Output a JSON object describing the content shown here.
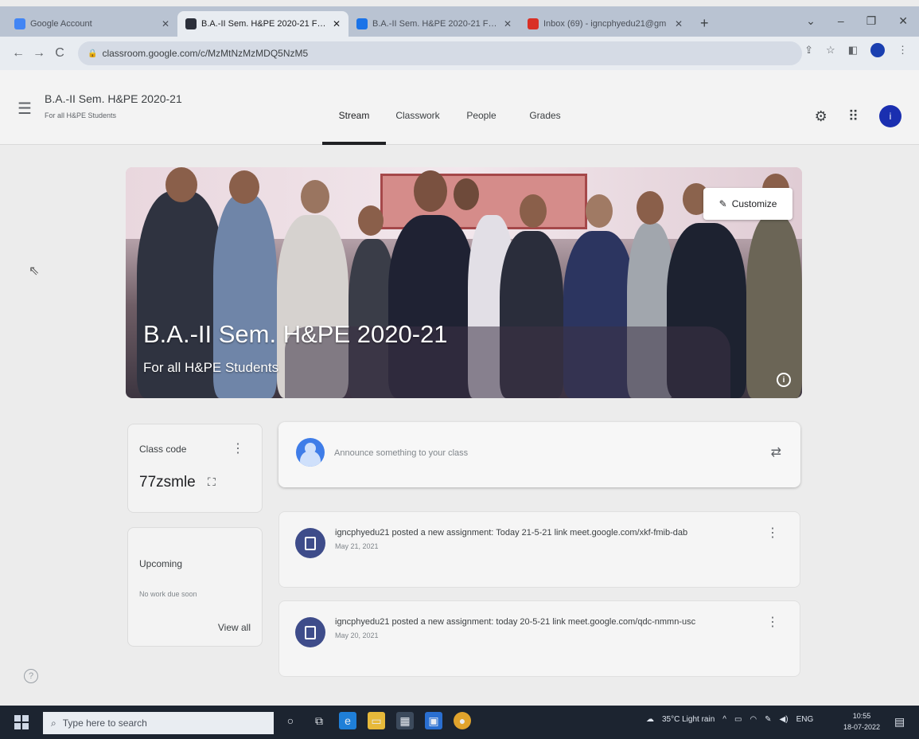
{
  "browser": {
    "tabs": [
      {
        "title": "Google Account",
        "favicon_color": "#4285f4",
        "active": false
      },
      {
        "title": "B.A.-II Sem. H&PE 2020-21 For al",
        "favicon_color": "#2b2f3a",
        "active": true
      },
      {
        "title": "B.A.-II Sem. H&PE 2020-21 For a",
        "favicon_color": "#1a73e8",
        "active": false
      },
      {
        "title": "Inbox (69) - igncphyedu21@gm",
        "favicon_color": "#d93025",
        "active": false
      }
    ],
    "new_tab": "+",
    "url": "classroom.google.com/c/MzMtNzMzMDQ5NzM5"
  },
  "header": {
    "class_title": "B.A.-II Sem. H&PE 2020-21",
    "class_subtitle": "For all H&PE Students",
    "tabs": [
      "Stream",
      "Classwork",
      "People",
      "Grades"
    ],
    "active_tab": "Stream",
    "avatar_letter": "i"
  },
  "banner": {
    "title": "B.A.-II Sem. H&PE 2020-21",
    "subtitle": "For all H&PE Students",
    "customize_label": "Customize"
  },
  "class_code": {
    "label": "Class code",
    "code": "77zsmle"
  },
  "upcoming": {
    "label": "Upcoming",
    "empty_text": "No work due soon",
    "view_all": "View all"
  },
  "announce": {
    "placeholder": "Announce something to your class"
  },
  "posts": [
    {
      "text": "igncphyedu21 posted a new assignment: Today 21-5-21 link meet.google.com/xkf-fmib-dab",
      "date": "May 21, 2021"
    },
    {
      "text": "igncphyedu21 posted a new assignment: today 20-5-21 link meet.google.com/qdc-nmmn-usc",
      "date": "May 20, 2021"
    }
  ],
  "taskbar": {
    "search_placeholder": "Type here to search",
    "weather": "35°C  Light rain",
    "lang": "ENG",
    "time": "10:55",
    "date": "18-07-2022"
  }
}
